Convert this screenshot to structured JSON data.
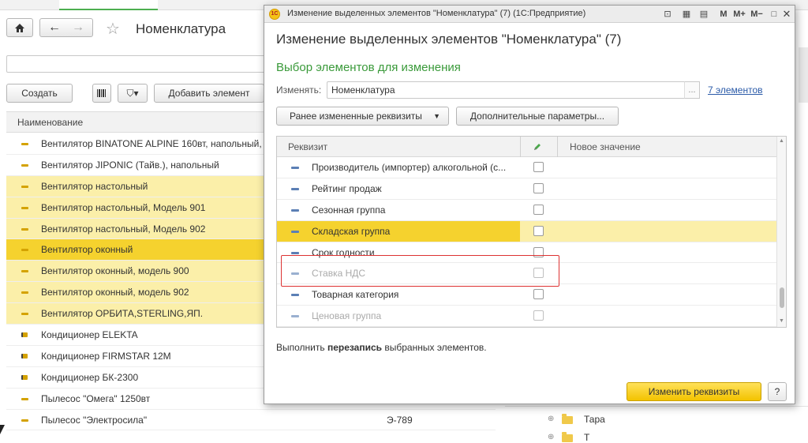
{
  "background": {
    "title": "Номенклатура",
    "buttons": {
      "create": "Создать",
      "add_element": "Добавить элемент"
    },
    "column_header": "Наименование",
    "rows": [
      {
        "name": "Вентилятор BINATONE ALPINE 160вт, напольный,",
        "code": "",
        "state": "normal"
      },
      {
        "name": "Вентилятор JIPONIC (Тайв.), напольный",
        "code": "",
        "state": "normal"
      },
      {
        "name": "Вентилятор настольный",
        "code": "",
        "state": "highlight"
      },
      {
        "name": "Вентилятор настольный, Модель 901",
        "code": "",
        "state": "highlight"
      },
      {
        "name": "Вентилятор настольный, Модель 902",
        "code": "",
        "state": "highlight"
      },
      {
        "name": "Вентилятор оконный",
        "code": "",
        "state": "selected"
      },
      {
        "name": "Вентилятор оконный, модель 900",
        "code": "",
        "state": "highlight"
      },
      {
        "name": "Вентилятор оконный, модель 902",
        "code": "",
        "state": "highlight"
      },
      {
        "name": "Вентилятор ОРБИТА,STERLING,ЯП.",
        "code": "",
        "state": "highlight"
      },
      {
        "name": "Кондиционер ELEKTA",
        "code": "",
        "state": "doc"
      },
      {
        "name": "Кондиционер FIRMSTAR 12М",
        "code": "",
        "state": "doc"
      },
      {
        "name": "Кондиционер БК-2300",
        "code": "",
        "state": "doc"
      },
      {
        "name": "Пылесос \"Омега\" 1250вт",
        "code": "",
        "state": "normal"
      },
      {
        "name": "Пылесос \"Электросила\"",
        "code": "Э-789",
        "state": "normal"
      }
    ],
    "tree_item": "Тара",
    "tree_item_partial": "Т"
  },
  "dialog": {
    "window_title": "Изменение выделенных элементов \"Номенклатура\" (7)  (1С:Предприятие)",
    "heading": "Изменение выделенных элементов \"Номенклатура\" (7)",
    "subheading": "Выбор элементов для изменения",
    "change_label": "Изменять:",
    "change_value": "Номенклатура",
    "dots": "...",
    "elements_link": "7 элементов",
    "btn_prev": "Ранее измененные реквизиты",
    "btn_more": "Дополнительные параметры...",
    "col_attr": "Реквизит",
    "col_new": "Новое значение",
    "rows": [
      {
        "name": "Производитель (импортер) алкогольной (с...",
        "state": "normal"
      },
      {
        "name": "Рейтинг продаж",
        "state": "normal"
      },
      {
        "name": "Сезонная группа",
        "state": "normal"
      },
      {
        "name": "Складская группа",
        "state": "selected"
      },
      {
        "name": "Срок годности",
        "state": "normal"
      },
      {
        "name": "Ставка НДС",
        "state": "disabled"
      },
      {
        "name": "Товарная категория",
        "state": "normal"
      },
      {
        "name": "Ценовая группа",
        "state": "disabled"
      }
    ],
    "note_before": "Выполнить ",
    "note_bold": "перезапись",
    "note_after": " выбранных элементов.",
    "btn_apply": "Изменить реквизиты",
    "btn_help": "?",
    "toolbar": {
      "m": "M",
      "mplus": "M+",
      "mminus": "M−"
    }
  }
}
